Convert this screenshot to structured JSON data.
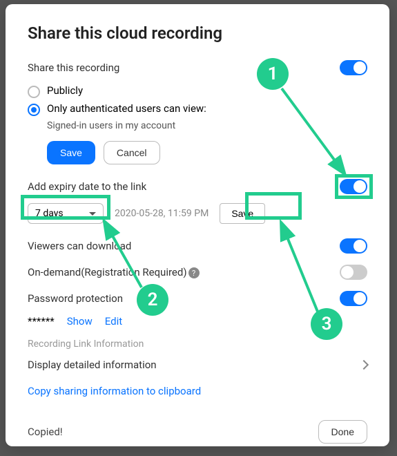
{
  "annotations": {
    "b1": "1",
    "b2": "2",
    "b3": "3"
  },
  "title": "Share this cloud recording",
  "share_section": {
    "label": "Share this recording",
    "toggle_on": true,
    "option_public": "Publicly",
    "option_auth": "Only authenticated users can view:",
    "option_auth_sub": "Signed-in users in my account",
    "save": "Save",
    "cancel": "Cancel"
  },
  "expiry": {
    "label": "Add expiry date to the link",
    "toggle_on": true,
    "select_value": "7 days",
    "timestamp": "2020-05-28, 11:59 PM",
    "save": "Save"
  },
  "viewers_download": {
    "label": "Viewers can download",
    "toggle_on": true
  },
  "on_demand": {
    "label": "On-demand(Registration Required)",
    "help": "?",
    "toggle_on": false
  },
  "password": {
    "label": "Password protection",
    "toggle_on": true,
    "masked": "******",
    "show": "Show",
    "edit": "Edit"
  },
  "link_info": {
    "heading": "Recording Link Information",
    "display": "Display detailed information",
    "copy": "Copy sharing information to clipboard"
  },
  "footer": {
    "copied": "Copied!",
    "done": "Done"
  }
}
